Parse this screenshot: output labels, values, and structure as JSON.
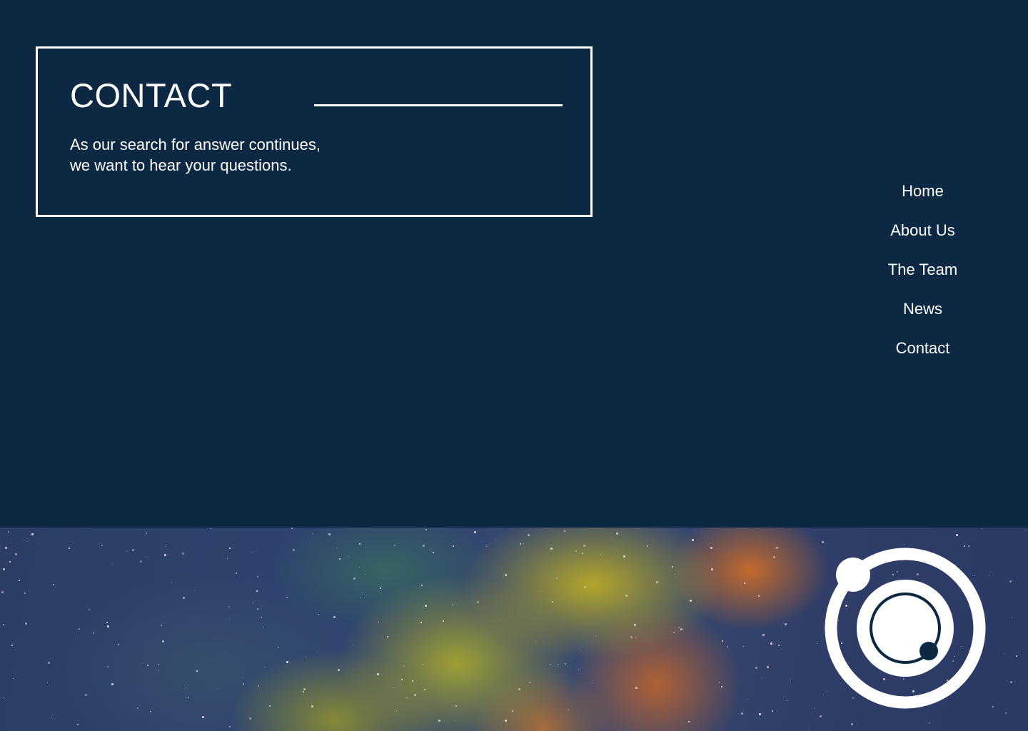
{
  "header": {
    "title": "CONTACT",
    "subtitle_line1": "As our search for answer continues,",
    "subtitle_line2": "we want to hear your questions."
  },
  "nav": {
    "items": [
      {
        "label": "Home"
      },
      {
        "label": "About Us"
      },
      {
        "label": "The Team"
      },
      {
        "label": "News"
      },
      {
        "label": "Contact"
      }
    ]
  },
  "footer": {
    "logo_icon": "orbit-logo-icon",
    "banner_image": "nebula-image"
  },
  "colors": {
    "background": "#0c2842",
    "text": "#ffffff",
    "frame": "#ffffff"
  }
}
